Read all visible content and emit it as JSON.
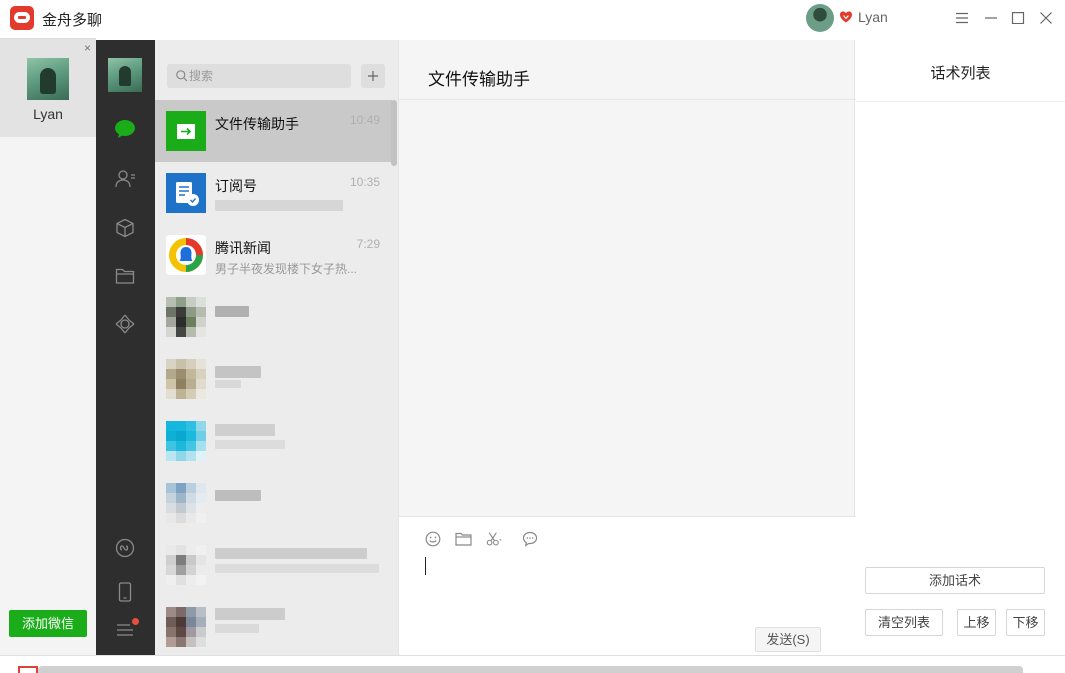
{
  "app": {
    "title": "金舟多聊",
    "user_name": "Lyan",
    "accent": "#1aad19",
    "brand": "#e23b2e"
  },
  "window_controls": [
    "menu-icon",
    "minimize-icon",
    "maximize-icon",
    "close-icon"
  ],
  "accounts": {
    "items": [
      {
        "name": "Lyan",
        "close": "×"
      }
    ],
    "add_button": "添加微信"
  },
  "sidebar": {
    "icons": [
      "chat-icon",
      "contacts-icon",
      "box-icon",
      "folder-icon",
      "moments-icon",
      "mini-program-icon",
      "phone-icon",
      "menu-icon"
    ]
  },
  "chat_list": {
    "search_placeholder": "搜索",
    "plus": "+",
    "items": [
      {
        "name": "文件传输助手",
        "time": "10:49",
        "preview": "",
        "active": true
      },
      {
        "name": "订阅号",
        "time": "10:35",
        "preview": ""
      },
      {
        "name": "腾讯新闻",
        "time": "7:29",
        "preview": "男子半夜发现楼下女子热..."
      }
    ]
  },
  "chat": {
    "title": "文件传输助手",
    "toolbar": [
      "emoji-icon",
      "folder-icon",
      "scissors-icon",
      "chat-bubble-icon"
    ],
    "send_label": "发送(S)"
  },
  "script_panel": {
    "title": "话术列表",
    "add_label": "添加话术",
    "clear_label": "清空列表",
    "move_up_label": "上移",
    "move_down_label": "下移"
  }
}
